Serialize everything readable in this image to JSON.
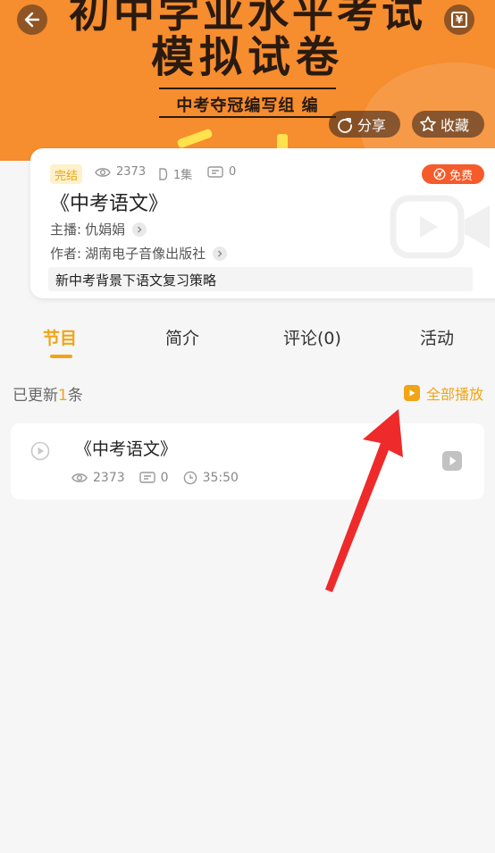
{
  "banner": {
    "cover_line1": "初中学业水平考试",
    "cover_line2": "模拟试卷",
    "cover_author": "中考夺冠编写组 编",
    "share_label": "分享",
    "collect_label": "收藏"
  },
  "album": {
    "status": "完结",
    "plays": "2373",
    "episodes": "1集",
    "comments": "0",
    "price_badge": "免费",
    "title": "《中考语文》",
    "host_label": "主播:",
    "host": "仇娟娟",
    "author_label": "作者:",
    "author": "湖南电子音像出版社",
    "description": "新中考背景下语文复习策略"
  },
  "tabs": [
    {
      "label": "节目"
    },
    {
      "label": "简介"
    },
    {
      "label": "评论(0)"
    },
    {
      "label": "活动"
    }
  ],
  "list": {
    "updated_prefix": "已更新",
    "updated_count": "1",
    "updated_suffix": "条",
    "play_all_label": "全部播放"
  },
  "episodes": [
    {
      "title": "《中考语文》",
      "plays": "2373",
      "comments": "0",
      "duration": "35:50"
    }
  ],
  "colors": {
    "banner": "#f68d2e",
    "accent": "#f1a515",
    "free_badge": "#f55b2b",
    "annotation_arrow": "#ee2a2a"
  },
  "icons": [
    "back-arrow-icon",
    "yen-icon",
    "share-icon",
    "star-icon",
    "eye-icon",
    "episode-icon",
    "comment-icon",
    "free-icon",
    "chevron-right-icon",
    "video-icon",
    "play-square-icon",
    "play-circle-icon",
    "clock-icon"
  ]
}
